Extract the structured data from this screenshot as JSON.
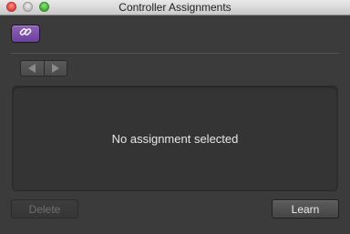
{
  "window": {
    "title": "Controller Assignments"
  },
  "toolbar": {
    "link_button_icon": "link-icon",
    "link_button_color": "#7b4fac"
  },
  "navigation": {
    "previous_icon": "left-arrow-icon",
    "next_icon": "right-arrow-icon"
  },
  "panel": {
    "message": "No assignment selected"
  },
  "buttons": {
    "delete_label": "Delete",
    "learn_label": "Learn"
  }
}
